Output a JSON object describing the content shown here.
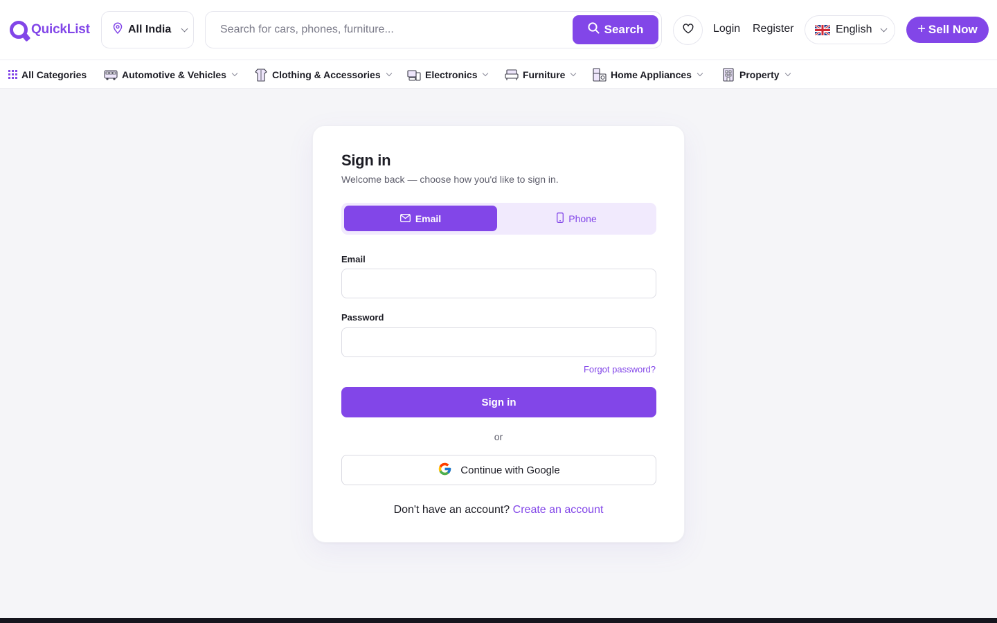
{
  "header": {
    "brand": "QuickList",
    "location": "All India",
    "search_placeholder": "Search for cars, phones, furniture...",
    "search_button": "Search",
    "login": "Login",
    "register": "Register",
    "language": "English",
    "sell_button": "Sell Now"
  },
  "categories": [
    {
      "label": "All Categories",
      "icon": "grid-icon"
    },
    {
      "label": "Automotive & Vehicles",
      "icon": "bus-icon"
    },
    {
      "label": "Clothing & Accessories",
      "icon": "clothing-icon"
    },
    {
      "label": "Electronics",
      "icon": "electronics-icon"
    },
    {
      "label": "Furniture",
      "icon": "sofa-icon"
    },
    {
      "label": "Home Appliances",
      "icon": "appliance-icon"
    },
    {
      "label": "Property",
      "icon": "building-icon"
    }
  ],
  "signin": {
    "title": "Sign in",
    "subtitle": "Welcome back — choose how you'd like to sign in.",
    "tab_email": "Email",
    "tab_phone": "Phone",
    "email_label": "Email",
    "email_value": "",
    "password_label": "Password",
    "password_value": "",
    "forgot": "Forgot password?",
    "submit": "Sign in",
    "or": "or",
    "google": "Continue with Google",
    "no_account": "Don't have an account?",
    "create_account": "Create an account"
  },
  "colors": {
    "accent": "#8246e8",
    "accent_soft": "#f1eafd",
    "page_bg": "#f5f5f8",
    "footer": "#15151d"
  }
}
